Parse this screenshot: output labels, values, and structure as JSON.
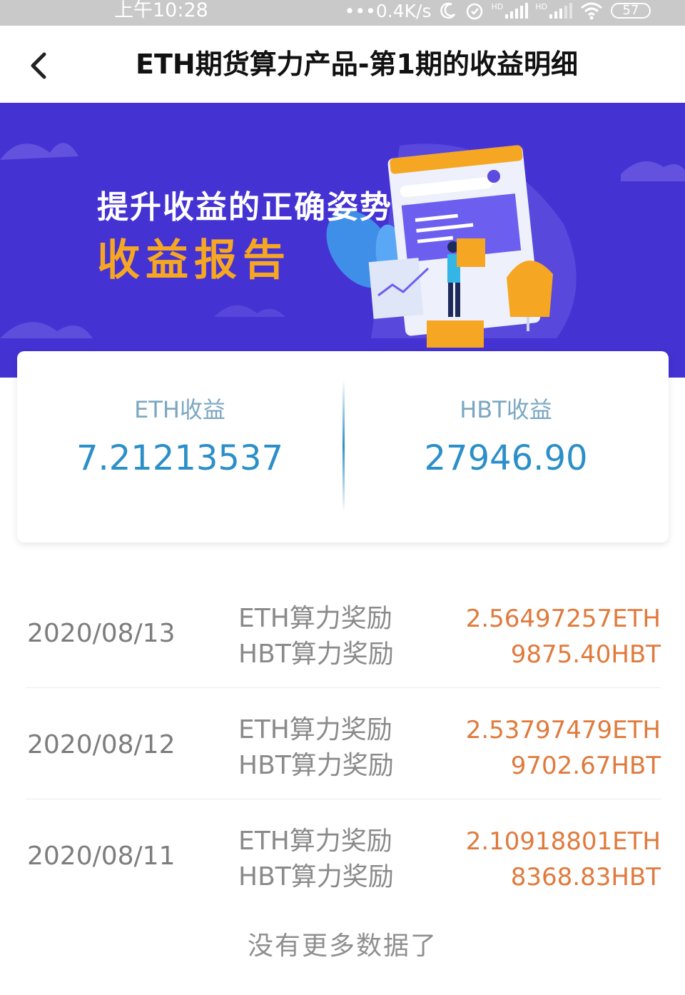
{
  "status_bar": {
    "time": "上午10:28",
    "network_speed": "•••0.4K/s",
    "signal_label_1": "HD",
    "signal_label_2": "HD",
    "battery": "57",
    "icons": [
      "moon-icon",
      "alarm-icon",
      "signal-icon",
      "signal-icon",
      "wifi-icon",
      "battery-icon"
    ]
  },
  "nav": {
    "title": "ETH期货算力产品-第1期的收益明细",
    "back_icon": "chevron-left-icon"
  },
  "banner": {
    "line1": "提升收益的正确姿势",
    "line2": "收益报告",
    "colors": {
      "background": "#4532d3",
      "accent": "#f5a623"
    }
  },
  "summary": {
    "eth_label": "ETH收益",
    "eth_value": "7.21213537",
    "hbt_label": "HBT收益",
    "hbt_value": "27946.90"
  },
  "rewards": [
    {
      "date": "2020/08/13",
      "type_eth": "ETH算力奖励",
      "type_hbt": "HBT算力奖励",
      "amount_eth": "2.56497257ETH",
      "amount_hbt": "9875.40HBT"
    },
    {
      "date": "2020/08/12",
      "type_eth": "ETH算力奖励",
      "type_hbt": "HBT算力奖励",
      "amount_eth": "2.53797479ETH",
      "amount_hbt": "9702.67HBT"
    },
    {
      "date": "2020/08/11",
      "type_eth": "ETH算力奖励",
      "type_hbt": "HBT算力奖励",
      "amount_eth": "2.10918801ETH",
      "amount_hbt": "8368.83HBT"
    }
  ],
  "footer": {
    "no_more": "没有更多数据了"
  },
  "colors": {
    "value_blue": "#2b8fc9",
    "amount_orange": "#e07a3c"
  }
}
